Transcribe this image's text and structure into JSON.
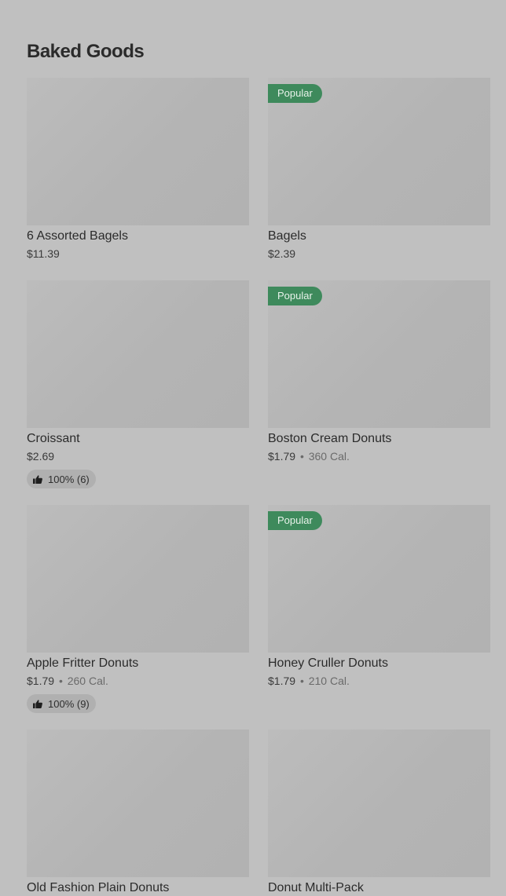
{
  "top_fragments": [
    "$###",
    "$###"
  ],
  "section": {
    "title": "Baked Goods"
  },
  "colors": {
    "background": "#c0c0c0",
    "popular_badge": "#3e8a5c",
    "rating_pill": "#b0b0b0"
  },
  "items": [
    {
      "name": "6 Assorted Bagels",
      "price": "$11.39",
      "calories": "",
      "badge": "",
      "rating": ""
    },
    {
      "name": "Bagels",
      "price": "$2.39",
      "calories": "",
      "badge": "Popular",
      "rating": ""
    },
    {
      "name": "Croissant",
      "price": "$2.69",
      "calories": "",
      "badge": "",
      "rating": "100% (6)"
    },
    {
      "name": "Boston Cream Donuts",
      "price": "$1.79",
      "calories": "360 Cal.",
      "badge": "Popular",
      "rating": ""
    },
    {
      "name": "Apple Fritter Donuts",
      "price": "$1.79",
      "calories": "260 Cal.",
      "badge": "",
      "rating": "100% (9)"
    },
    {
      "name": "Honey Cruller Donuts",
      "price": "$1.79",
      "calories": "210 Cal.",
      "badge": "Popular",
      "rating": ""
    },
    {
      "name": "Old Fashion Plain Donuts",
      "price": "",
      "calories": "",
      "badge": "",
      "rating": ""
    },
    {
      "name": "Donut Multi-Pack",
      "price": "",
      "calories": "",
      "badge": "",
      "rating": ""
    }
  ],
  "icons": {
    "rating": "thumbs-up-icon"
  }
}
